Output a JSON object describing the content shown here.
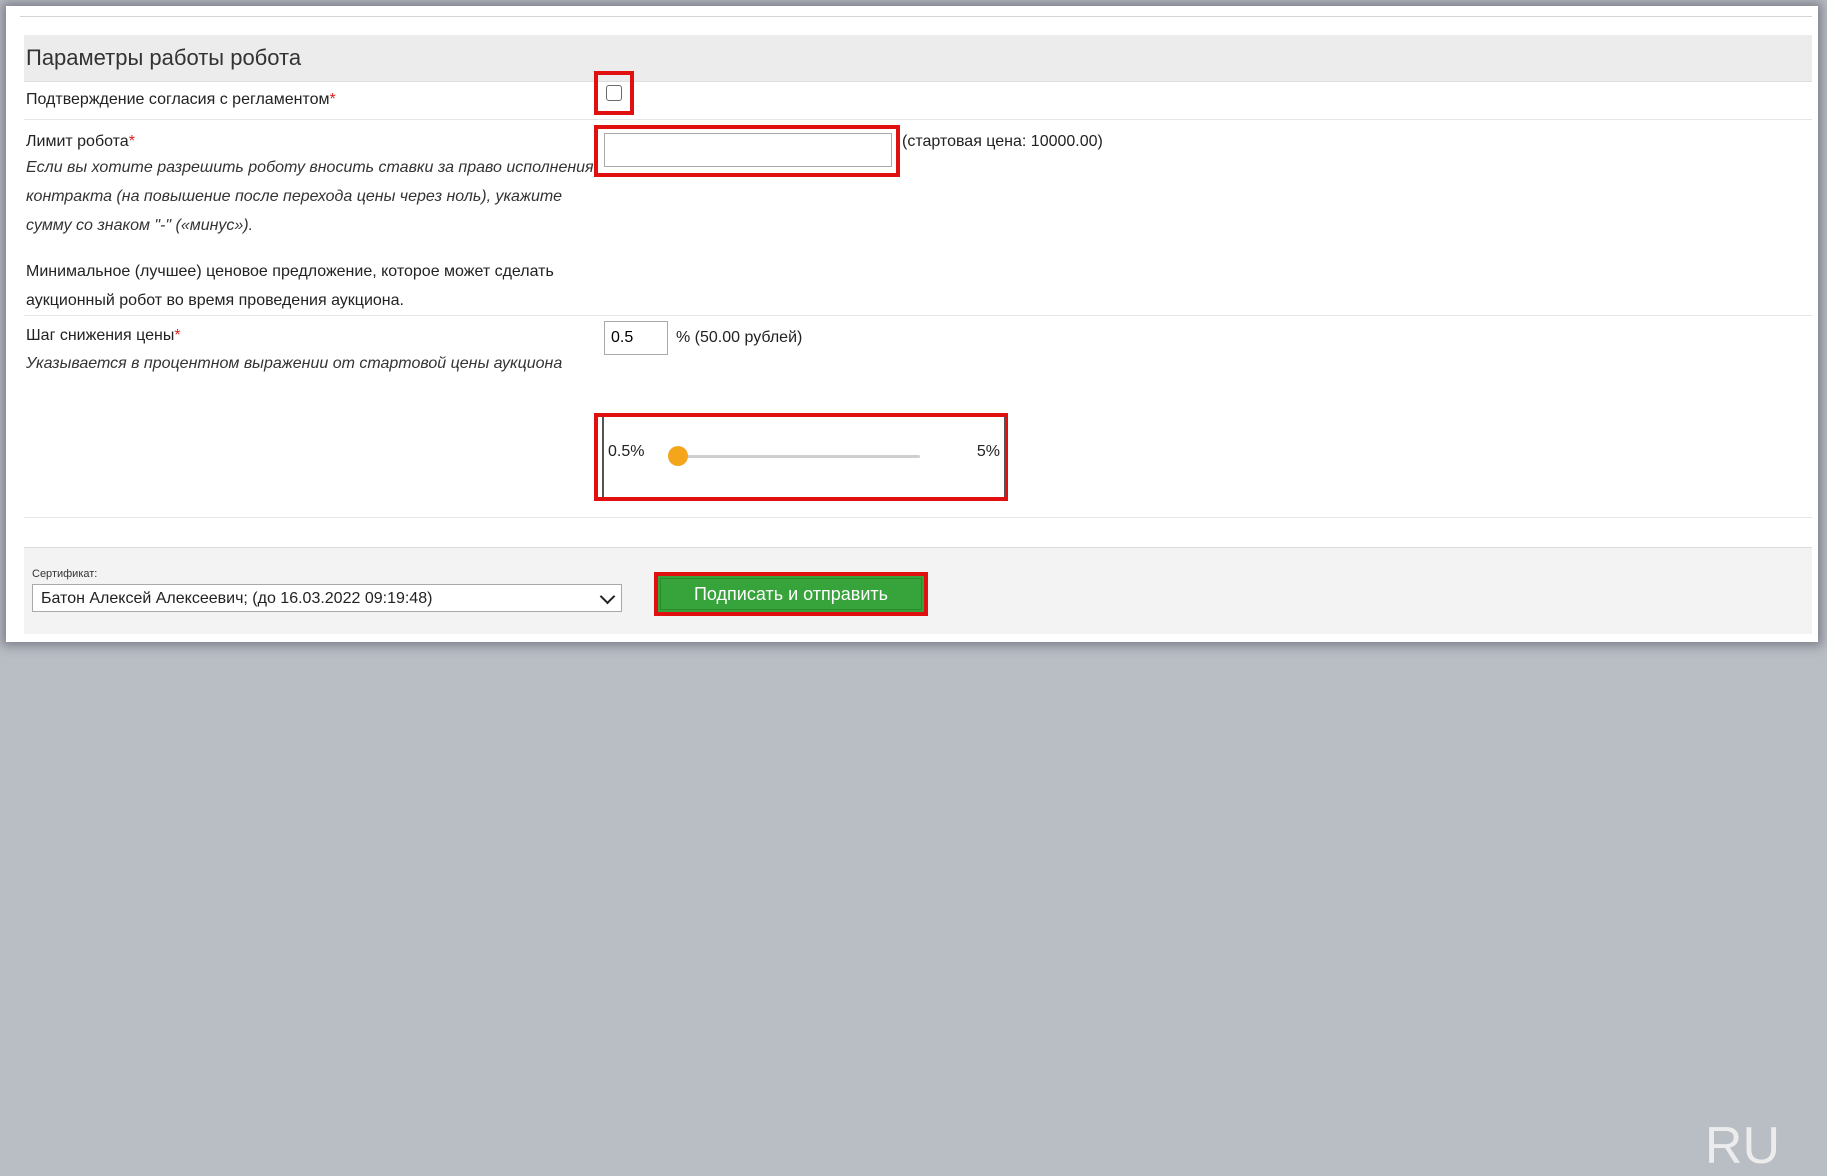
{
  "section": {
    "title": "Параметры работы робота"
  },
  "consent": {
    "label": "Подтверждение согласия с регламентом",
    "required_mark": "*",
    "checked": false
  },
  "limit": {
    "label": "Лимит робота",
    "required_mark": "*",
    "hint": "Если вы хотите разрешить роботу вносить ставки за право исполнения контракта (на повышение после перехода цены через ноль), укажите сумму со знаком \"-\" («минус»).",
    "description": "Минимальное (лучшее) ценовое предложение, которое может сделать аукционный робот во время проведения аукциона.",
    "value": "",
    "start_price_note": "(стартовая цена: 10000.00)"
  },
  "step": {
    "label": "Шаг снижения цены",
    "required_mark": "*",
    "hint": "Указывается в процентном выражении от стартовой цены аукциона",
    "value": "0.5",
    "suffix": "% (50.00 рублей)",
    "slider_min_label": "0.5%",
    "slider_max_label": "5%",
    "slider_fraction": 0.0
  },
  "footer": {
    "certificate_label": "Сертификат:",
    "certificate_selected": "Батон Алексей Алексеевич; (до 16.03.2022 09:19:48)",
    "submit_label": "Подписать и отправить",
    "watermark": "RU"
  },
  "colors": {
    "highlight": "#e01010",
    "submit_bg": "#37a33b",
    "slider_thumb": "#f3a51b",
    "required": "#e02020"
  }
}
